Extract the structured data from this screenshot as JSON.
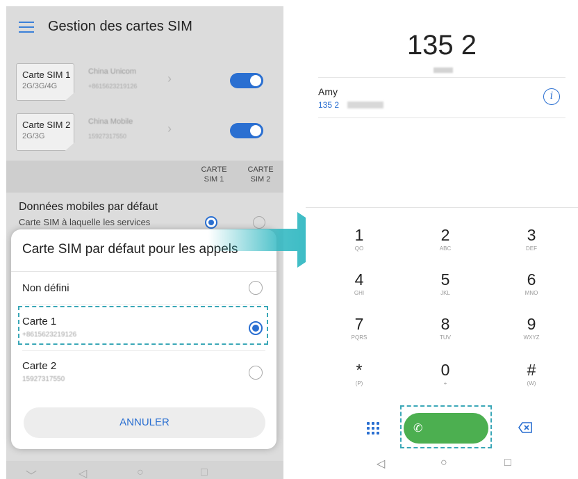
{
  "left_screen": {
    "title": "Gestion des cartes SIM",
    "sims": [
      {
        "name": "Carte SIM 1",
        "network": "2G/3G/4G",
        "operator": "China Unicom",
        "number": "+8615623219126",
        "enabled": true
      },
      {
        "name": "Carte SIM 2",
        "network": "2G/3G",
        "operator": "China Mobile",
        "number": "15927317550",
        "enabled": true
      }
    ],
    "columns": {
      "sim1_line1": "CARTE",
      "sim1_line2": "SIM 1",
      "sim2_line1": "CARTE",
      "sim2_line2": "SIM 2"
    },
    "mobile_data": {
      "title": "Données mobiles par défaut",
      "subtitle": "Carte SIM à laquelle les services"
    },
    "dialog": {
      "title": "Carte SIM par défaut pour les appels",
      "options": [
        {
          "label": "Non défini",
          "sub": "",
          "selected": false
        },
        {
          "label": "Carte 1",
          "sub": "+8615623219126",
          "selected": true
        },
        {
          "label": "Carte 2",
          "sub": "15927317550",
          "selected": false
        }
      ],
      "cancel_label": "ANNULER"
    },
    "nav": {
      "back": "◁",
      "home": "○",
      "recent": "□",
      "down": "﹀"
    }
  },
  "right_screen": {
    "dialed_number": "135 2",
    "contact": {
      "name": "Amy",
      "number": "135 2"
    },
    "keypad": [
      {
        "digit": "1",
        "letters": "QO"
      },
      {
        "digit": "2",
        "letters": "ABC"
      },
      {
        "digit": "3",
        "letters": "DEF"
      },
      {
        "digit": "4",
        "letters": "GHI"
      },
      {
        "digit": "5",
        "letters": "JKL"
      },
      {
        "digit": "6",
        "letters": "MNO"
      },
      {
        "digit": "7",
        "letters": "PQRS"
      },
      {
        "digit": "8",
        "letters": "TUV"
      },
      {
        "digit": "9",
        "letters": "WXYZ"
      },
      {
        "digit": "*",
        "letters": "(P)"
      },
      {
        "digit": "0",
        "letters": "+"
      },
      {
        "digit": "#",
        "letters": "(W)"
      }
    ],
    "nav": {
      "back": "◁",
      "home": "○",
      "recent": "□"
    }
  },
  "colors": {
    "accent_blue": "#2a6fd1",
    "call_green": "#4caf50",
    "highlight_teal": "#3aa7b7",
    "arrow_teal": "#2bb6c0"
  }
}
